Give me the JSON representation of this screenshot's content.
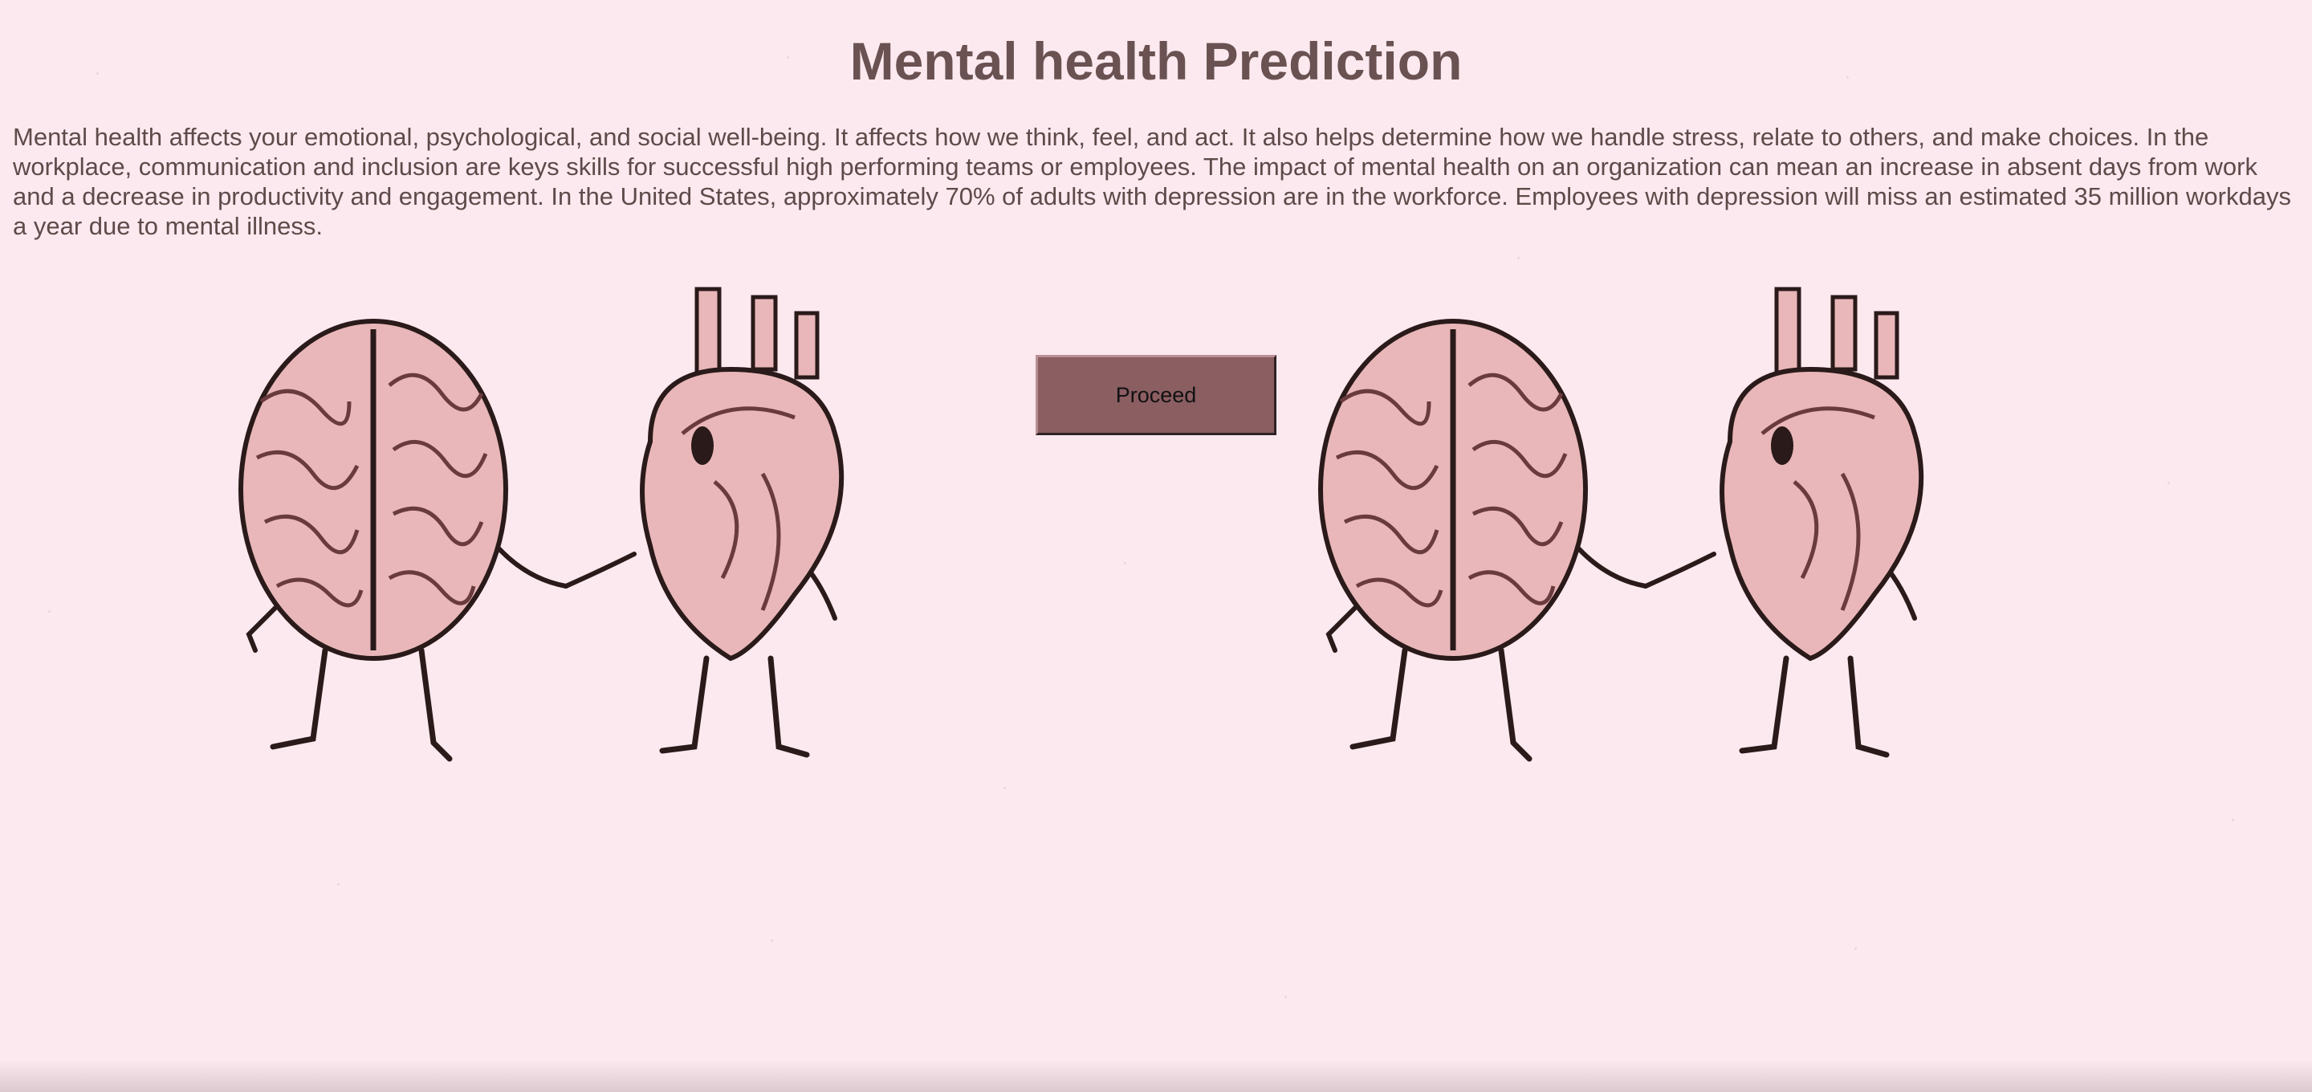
{
  "page": {
    "title": "Mental health Prediction",
    "intro": "Mental health affects your emotional, psychological, and social well-being. It affects how we think, feel, and act. It also helps determine how we handle stress, relate to others, and make choices. In the workplace, communication and inclusion are keys skills for successful high performing teams or employees. The impact of mental health on an organization can mean an increase in absent days from work and a decrease in productivity and engagement. In the United States, approximately 70% of adults with depression are in the workforce. Employees with depression will miss an estimated 35 million workdays a year due to mental illness.",
    "proceed_label": "Proceed"
  },
  "illustrations": [
    {
      "icon": "brain-and-heart-holding-hands"
    },
    {
      "icon": "brain-and-heart-holding-hands"
    }
  ],
  "colors": {
    "background": "#fbe9ef",
    "heading": "#6a5252",
    "text": "#5f4a4a",
    "button": "#8b5e62",
    "illustration_fill": "#e9b7b9",
    "illustration_ink": "#2a1a1a"
  }
}
